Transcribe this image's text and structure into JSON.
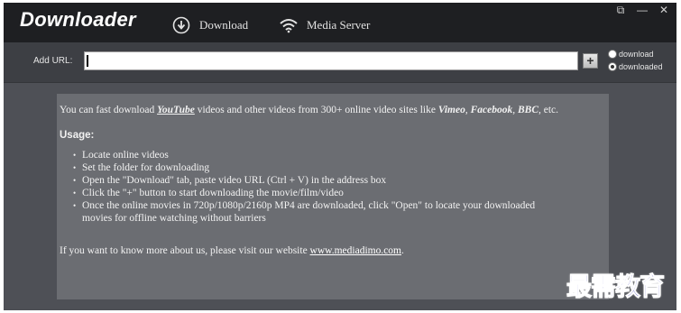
{
  "header": {
    "app_title": "Downloader",
    "tabs": [
      {
        "label": "Download",
        "icon": "download-circle-icon"
      },
      {
        "label": "Media Server",
        "icon": "wifi-icon"
      }
    ],
    "window_controls": [
      {
        "name": "popout",
        "glyph": "⧉"
      },
      {
        "name": "minimize",
        "glyph": "—"
      },
      {
        "name": "close",
        "glyph": "✕"
      }
    ]
  },
  "url_bar": {
    "label": "Add URL:",
    "value": "",
    "add_button": "+",
    "radio_options": [
      {
        "label": "download",
        "checked": false
      },
      {
        "label": "downloaded",
        "checked": true
      }
    ]
  },
  "info": {
    "intro_prefix": "You can fast download ",
    "intro_youtube": "YouTube",
    "intro_middle": " videos and other videos from 300+ online video sites like ",
    "intro_vimeo": "Vimeo",
    "intro_sep1": ", ",
    "intro_facebook": "Facebook",
    "intro_sep2": ", ",
    "intro_bbc": "BBC",
    "intro_suffix": ", etc.",
    "usage_title": "Usage:",
    "usage_items": [
      "Locate online videos",
      "Set the folder for downloading",
      "Open the \"Download\" tab, paste video URL (Ctrl + V) in the address box",
      "Click the \"+\" button to start downloading the movie/film/video",
      "Once the online movies in 720p/1080p/2160p MP4 are downloaded, click \"Open\" to locate your downloaded"
    ],
    "usage_item_continuation": "movies for offline watching without barriers",
    "more_prefix": "If you want to know more about us, please visit our website ",
    "website": "www.mediadimo.com",
    "more_suffix": "."
  },
  "watermark": "最需教育",
  "colors": {
    "header_bg": "#1e1f22",
    "body_bg": "#4e5056",
    "panel_bg": "#6b6d72",
    "watermark": "#2e2eb8"
  }
}
